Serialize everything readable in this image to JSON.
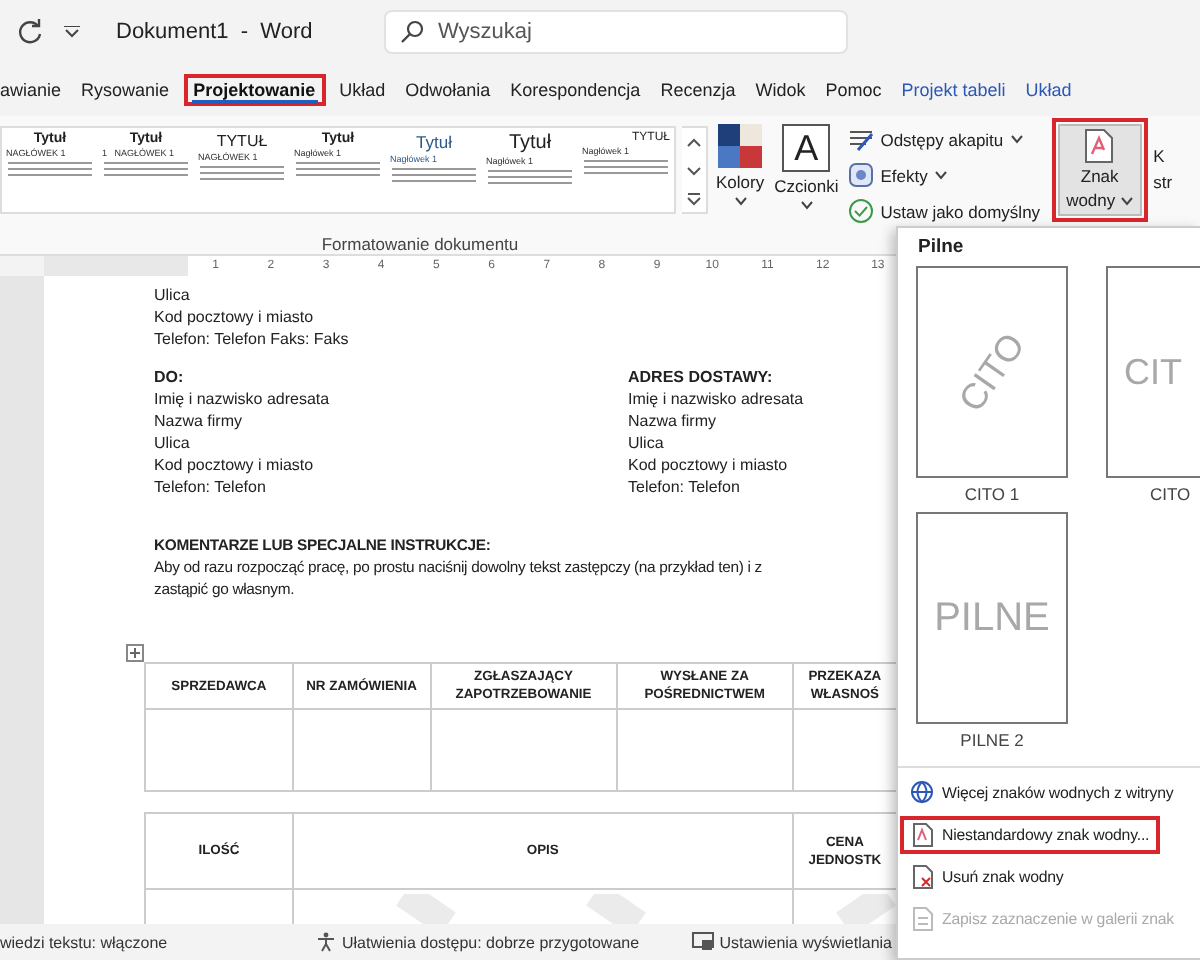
{
  "title_bar": {
    "title": "Dokument1  -  Word",
    "search": {
      "placeholder": "Wyszukaj"
    }
  },
  "tabs": [
    {
      "label": "awianie",
      "selected": false,
      "highlighted": false,
      "contextual": false
    },
    {
      "label": "Rysowanie",
      "selected": false,
      "highlighted": false,
      "contextual": false
    },
    {
      "label": "Projektowanie",
      "selected": true,
      "highlighted": true,
      "contextual": false
    },
    {
      "label": "Układ",
      "selected": false,
      "highlighted": false,
      "contextual": false
    },
    {
      "label": "Odwołania",
      "selected": false,
      "highlighted": false,
      "contextual": false
    },
    {
      "label": "Korespondencja",
      "selected": false,
      "highlighted": false,
      "contextual": false
    },
    {
      "label": "Recenzja",
      "selected": false,
      "highlighted": false,
      "contextual": false
    },
    {
      "label": "Widok",
      "selected": false,
      "highlighted": false,
      "contextual": false
    },
    {
      "label": "Pomoc",
      "selected": false,
      "highlighted": false,
      "contextual": false
    },
    {
      "label": "Projekt tabeli",
      "selected": false,
      "highlighted": false,
      "contextual": true
    },
    {
      "label": "Układ",
      "selected": false,
      "highlighted": false,
      "contextual": true
    }
  ],
  "ribbon": {
    "style_gallery": [
      {
        "title": "Tytuł",
        "heading": "NAGŁÓWEK 1",
        "kind": "bold"
      },
      {
        "title": "Tytuł",
        "heading": "1   NAGŁÓWEK 1",
        "kind": "bold"
      },
      {
        "title": "TYTUŁ",
        "heading": "NAGŁÓWEK 1",
        "kind": "caps"
      },
      {
        "title": "Tytuł",
        "heading": "Nagłówek 1",
        "kind": "bold"
      },
      {
        "title": "Tytuł",
        "heading": "Nagłówek 1",
        "kind": "blue"
      },
      {
        "title": "Tytuł",
        "heading": "Nagłówek 1",
        "kind": "large"
      },
      {
        "title": "TYTUŁ",
        "heading": "Nagłówek 1",
        "kind": "small"
      }
    ],
    "colors_button": {
      "label": "Kolory"
    },
    "fonts_button": {
      "label": "Czcionki",
      "glyph": "A"
    },
    "small_buttons": [
      {
        "label": "Odstępy akapitu",
        "kind": "spacing",
        "dropdown": true
      },
      {
        "label": "Efekty",
        "kind": "effects",
        "dropdown": true
      },
      {
        "label": "Ustaw jako domyślny",
        "kind": "default",
        "dropdown": false
      }
    ],
    "watermark_button": {
      "label_lines": [
        "Znak",
        "wodny"
      ],
      "highlighted": true,
      "pressed": true
    },
    "cut_button": {
      "label_lines": [
        "K",
        "str"
      ]
    },
    "group_label": "Formatowanie dokumentu"
  },
  "ruler": {
    "numbers": [
      "1",
      "2",
      "3",
      "4",
      "5",
      "6",
      "7",
      "8",
      "9",
      "10",
      "11",
      "12",
      "13"
    ]
  },
  "document": {
    "sender_lines": [
      "Ulica",
      "Kod pocztowy i miasto",
      "Telefon: Telefon Faks: Faks"
    ],
    "address_blocks": [
      {
        "heading": "DO:",
        "lines": [
          "Imię i nazwisko adresata",
          "Nazwa firmy",
          "Ulica",
          "Kod pocztowy i miasto",
          "Telefon: Telefon"
        ]
      },
      {
        "heading": "ADRES DOSTAWY:",
        "lines": [
          "Imię i nazwisko adresata",
          "Nazwa firmy",
          "Ulica",
          "Kod pocztowy i miasto",
          "Telefon: Telefon"
        ]
      }
    ],
    "comments": {
      "heading": "KOMENTARZE LUB SPECJALNE INSTRUKCJE:",
      "lines": [
        "Aby od razu rozpocząć pracę, po prostu naciśnij dowolny tekst zastępczy (na przykład ten) i z",
        "zastąpić go własnym."
      ]
    },
    "tables": [
      {
        "columns": [
          "SPRZEDAWCA",
          "NR ZAMÓWIENIA",
          "ZGŁASZAJĄCY ZAPOTRZEBOWANIE",
          "WYSŁANE ZA POŚREDNICTWEM",
          "PRZEKAZA WŁASNOŚ"
        ]
      },
      {
        "columns": [
          "ILOŚĆ",
          "OPIS",
          "CENA JEDNOSTK"
        ]
      }
    ]
  },
  "status_bar": [
    "wiedzi tekstu: włączone",
    "Ułatwienia dostępu: dobrze przygotowane",
    "Ustawienia wyświetlania"
  ],
  "watermark_menu": {
    "section": "Pilne",
    "gallery": [
      {
        "label": "CITO 1",
        "text": "CITO",
        "kind": "diagonal"
      },
      {
        "label": "CITO",
        "text": "CIT",
        "kind": "horizontal"
      },
      {
        "label": "PILNE 2",
        "text": "PILNE",
        "kind": "horizontal"
      }
    ],
    "items": [
      {
        "label": "Więcej znaków wodnych z witryny",
        "kind": "globe",
        "disabled": false,
        "highlighted": false
      },
      {
        "label": "Niestandardowy znak wodny...",
        "kind": "custom",
        "disabled": false,
        "highlighted": true
      },
      {
        "label": "Usuń znak wodny",
        "kind": "remove",
        "disabled": false,
        "highlighted": false
      },
      {
        "label": "Zapisz zaznaczenie w galerii znak",
        "kind": "save",
        "disabled": true,
        "highlighted": false
      }
    ]
  }
}
